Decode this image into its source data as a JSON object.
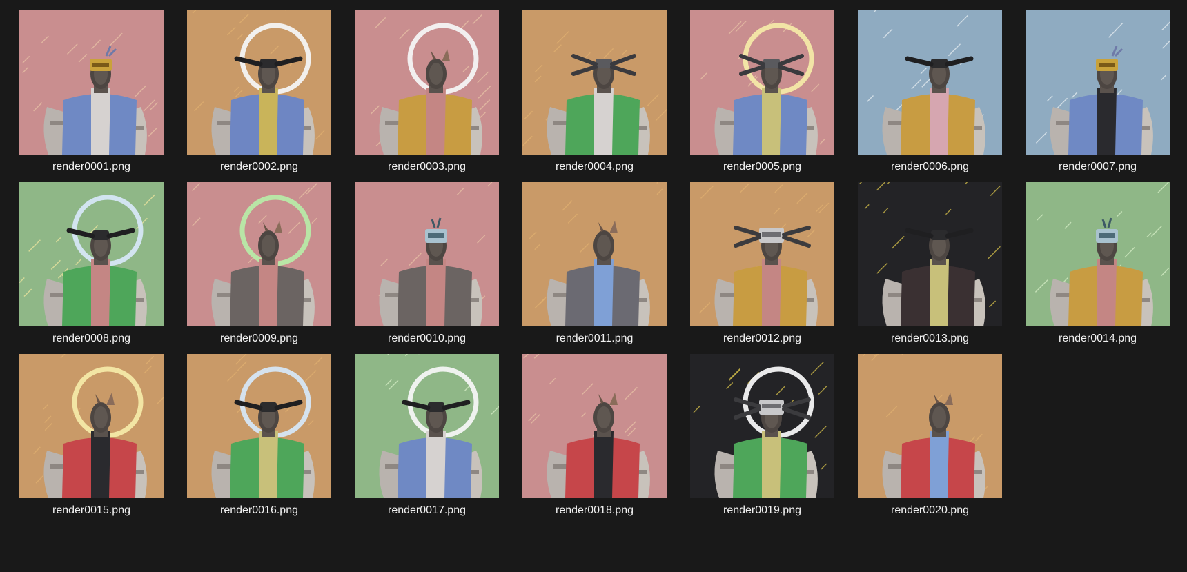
{
  "window": {
    "background": "#191919"
  },
  "files": [
    {
      "name": "render0001.png",
      "thumbnail": {
        "bg": "#c98e8f",
        "vest": "#6f89c4",
        "shirt": "#d6d2d0",
        "ring": "none",
        "head": "visor-yellow",
        "sparks": "#e8c3a6"
      }
    },
    {
      "name": "render0002.png",
      "thumbnail": {
        "bg": "#c99a68",
        "vest": "#6e86c3",
        "shirt": "#c9b45a",
        "ring": "#f4f4f4",
        "head": "antenna-black",
        "sparks": "#e0b070"
      }
    },
    {
      "name": "render0003.png",
      "thumbnail": {
        "bg": "#c98e8f",
        "vest": "#c89c42",
        "shirt": "#c48684",
        "ring": "#f4f4f4",
        "head": "horn",
        "sparks": "#e8c3a6"
      }
    },
    {
      "name": "render0004.png",
      "thumbnail": {
        "bg": "#c99a68",
        "vest": "#4ea65a",
        "shirt": "#d6d2d0",
        "ring": "none",
        "head": "antenna-grey",
        "sparks": "#e0b070"
      }
    },
    {
      "name": "render0005.png",
      "thumbnail": {
        "bg": "#c98e8f",
        "vest": "#6f89c4",
        "shirt": "#c8c07a",
        "ring": "#f4e9a8",
        "head": "antenna-grey",
        "sparks": "#e8c3a6"
      }
    },
    {
      "name": "render0006.png",
      "thumbnail": {
        "bg": "#8fabc1",
        "vest": "#c89c42",
        "shirt": "#d6a6b0",
        "ring": "none",
        "head": "antenna-black",
        "sparks": "#e8eef2"
      }
    },
    {
      "name": "render0007.png",
      "thumbnail": {
        "bg": "#8fabc1",
        "vest": "#6f89c4",
        "shirt": "#2a2a2e",
        "ring": "none",
        "head": "visor-yellow",
        "sparks": "#e8eef2"
      }
    },
    {
      "name": "render0008.png",
      "thumbnail": {
        "bg": "#8fb787",
        "vest": "#4ea65a",
        "shirt": "#c48684",
        "ring": "#d6e6f6",
        "head": "antenna-black",
        "sparks": "#f0e6a0"
      }
    },
    {
      "name": "render0009.png",
      "thumbnail": {
        "bg": "#c98e8f",
        "vest": "#6b6462",
        "shirt": "#c48684",
        "ring": "#b8eaa8",
        "head": "horn",
        "sparks": "#e8c3a6"
      }
    },
    {
      "name": "render0010.png",
      "thumbnail": {
        "bg": "#c98e8f",
        "vest": "#6b6462",
        "shirt": "#c48684",
        "ring": "none",
        "head": "visor-blue",
        "sparks": "#e8c3a6"
      }
    },
    {
      "name": "render0011.png",
      "thumbnail": {
        "bg": "#c99a68",
        "vest": "#6b6a72",
        "shirt": "#7fa0d6",
        "ring": "none",
        "head": "horn",
        "sparks": "#e0b070"
      }
    },
    {
      "name": "render0012.png",
      "thumbnail": {
        "bg": "#c99a68",
        "vest": "#c89c42",
        "shirt": "#c48684",
        "ring": "none",
        "head": "visor-grey",
        "sparks": "#e0b070"
      }
    },
    {
      "name": "render0013.png",
      "thumbnail": {
        "bg": "#232326",
        "vest": "#3a3032",
        "shirt": "#c8c07a",
        "ring": "none",
        "head": "antenna-black",
        "sparks": "#d8c24a"
      }
    },
    {
      "name": "render0014.png",
      "thumbnail": {
        "bg": "#8fb787",
        "vest": "#c89c42",
        "shirt": "#c48684",
        "ring": "none",
        "head": "visor-blue",
        "sparks": "#d8efc8"
      }
    },
    {
      "name": "render0015.png",
      "thumbnail": {
        "bg": "#c99a68",
        "vest": "#c6464a",
        "shirt": "#2a2a2e",
        "ring": "#f4e9a8",
        "head": "horn",
        "sparks": "#e0b070"
      }
    },
    {
      "name": "render0016.png",
      "thumbnail": {
        "bg": "#c99a68",
        "vest": "#4ea65a",
        "shirt": "#c8c07a",
        "ring": "#d6e6f6",
        "head": "antenna-black",
        "sparks": "#e0b070"
      }
    },
    {
      "name": "render0017.png",
      "thumbnail": {
        "bg": "#8fb787",
        "vest": "#6f89c4",
        "shirt": "#d6d2d0",
        "ring": "#f4f4f4",
        "head": "antenna-black",
        "sparks": "#d8efc8"
      }
    },
    {
      "name": "render0018.png",
      "thumbnail": {
        "bg": "#c98e8f",
        "vest": "#c6464a",
        "shirt": "#2a2a2e",
        "ring": "none",
        "head": "horn",
        "sparks": "#e8c3a6"
      }
    },
    {
      "name": "render0019.png",
      "thumbnail": {
        "bg": "#232326",
        "vest": "#4ea65a",
        "shirt": "#c8c07a",
        "ring": "#f4f4f4",
        "head": "visor-grey",
        "sparks": "#d8c24a"
      }
    },
    {
      "name": "render0020.png",
      "thumbnail": {
        "bg": "#c99a68",
        "vest": "#c6464a",
        "shirt": "#7fa0d6",
        "ring": "none",
        "head": "horn",
        "sparks": "#e0b070"
      }
    }
  ]
}
